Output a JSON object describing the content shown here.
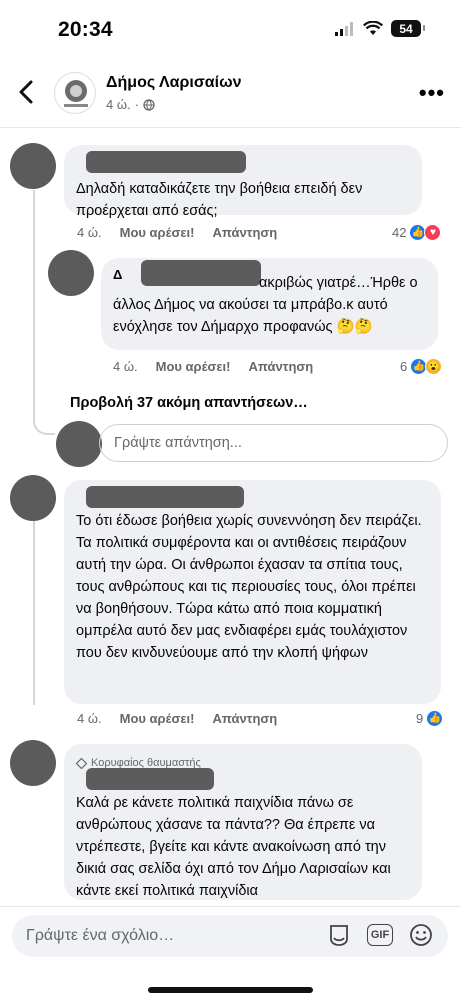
{
  "status_bar": {
    "time": "20:34",
    "battery": "54"
  },
  "header": {
    "page_name": "Δήμος Λαρισαίων",
    "time": "4 ώ.",
    "separator": "·"
  },
  "comments": [
    {
      "text": "Δηλαδή καταδικάζετε την βοήθεια επειδή δεν προέρχεται από εσάς;",
      "time": "4 ώ.",
      "like_label": "Μου αρέσει!",
      "reply_label": "Απάντηση",
      "reaction_count": "42"
    },
    {
      "author_fragment": "Δ",
      "text_right": "ακριβώς γιατρέ…Ήρθε ο",
      "text_rest": "άλλος Δήμος να ακούσει τα μπράβο.κ αυτό ενόχλησε τον Δήμαρχο προφανώς 🤔🤔",
      "time": "4 ώ.",
      "like_label": "Μου αρέσει!",
      "reply_label": "Απάντηση",
      "reaction_count": "6"
    },
    {
      "text": "Το ότι έδωσε βοήθεια χωρίς συνεννόηση δεν πειράζει.  Τα πολιτικά συμφέροντα και οι αντιθέσεις πειράζουν αυτή την ώρα.  Οι άνθρωποι έχασαν τα σπίτια τους, τους ανθρώπους και τις περιουσίες τους, όλοι πρέπει να βοηθήσουν.  Τώρα κάτω από ποια κομματική ομπρέλα αυτό δεν μας ενδιαφέρει εμάς τουλάχιστον που δεν κινδυνεύουμε από την κλοπή ψήφων",
      "time": "4 ώ.",
      "like_label": "Μου αρέσει!",
      "reply_label": "Απάντηση",
      "reaction_count": "9"
    },
    {
      "badge": "Κορυφαίος θαυμαστής",
      "text": "Καλά ρε κάνετε πολιτικά παιχνίδια πάνω σε ανθρώπους χάσανε τα πάντα?? Θα έπρεπε να ντρέπεστε, βγείτε και κάντε ανακοίνωση από την δικιά σας σελίδα όχι από τον Δήμο Λαρισαίων και κάντε εκεί πολιτικά παιχνίδια"
    }
  ],
  "more_replies": "Προβολή 37 ακόμη απαντήσεων…",
  "reply_placeholder": "Γράψτε απάντηση...",
  "comment_placeholder": "Γράψτε ένα σχόλιο…",
  "gif_label": "GIF",
  "colors": {
    "link": "#1877f2",
    "love": "#f33e58",
    "text_muted": "#65676b",
    "bubble": "#eef0f3"
  }
}
